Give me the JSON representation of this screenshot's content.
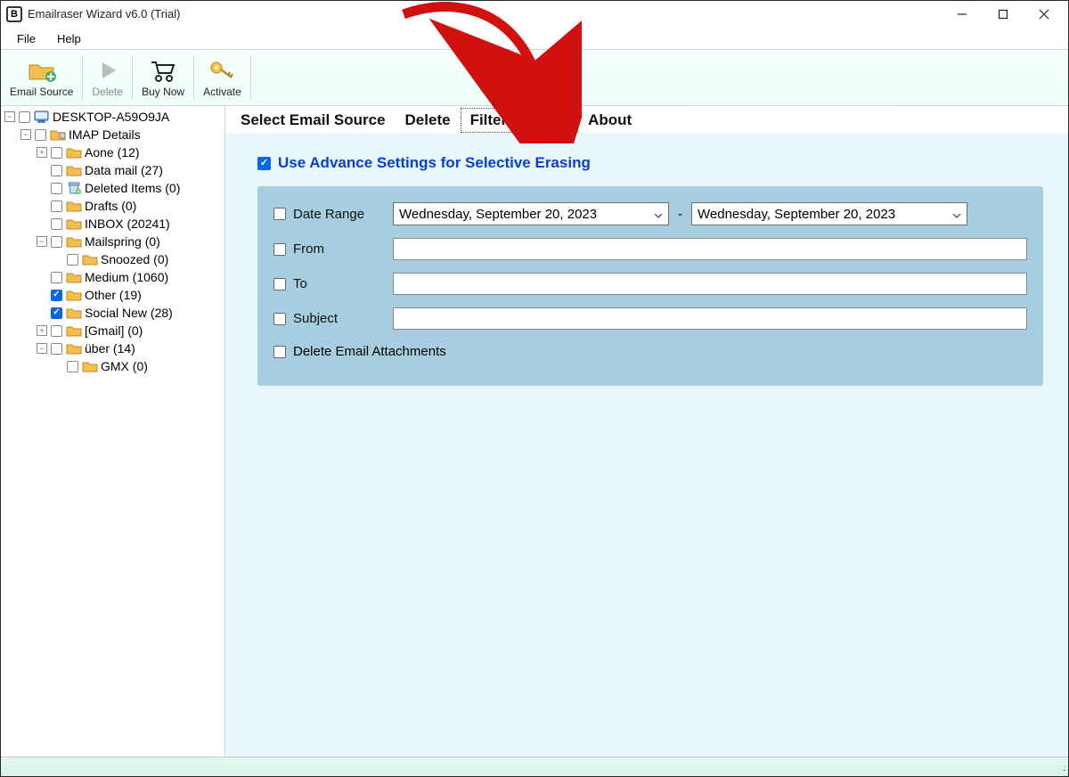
{
  "window": {
    "title": "Emailraser Wizard v6.0 (Trial)",
    "app_badge": "B"
  },
  "menu": {
    "file": "File",
    "help": "Help"
  },
  "toolbar": {
    "email_source": "Email Source",
    "delete": "Delete",
    "buy_now": "Buy Now",
    "activate": "Activate"
  },
  "tabs": {
    "select_source": "Select Email Source",
    "delete": "Delete",
    "filter": "Filter Options",
    "about": "About"
  },
  "filter": {
    "use_advance": "Use Advance Settings for Selective Erasing",
    "date_range": "Date Range",
    "date_from": "Wednesday, September 20, 2023",
    "date_to": "Wednesday, September 20, 2023",
    "dash": "-",
    "from": "From",
    "to": "To",
    "subject": "Subject",
    "del_attach": "Delete Email Attachments"
  },
  "tree": [
    {
      "indent": 0,
      "twist": "-",
      "cb": false,
      "icon": "pc",
      "label": "DESKTOP-A59O9JA"
    },
    {
      "indent": 1,
      "twist": "-",
      "cb": false,
      "icon": "folderdb",
      "label": "IMAP Details"
    },
    {
      "indent": 2,
      "twist": "+",
      "cb": false,
      "icon": "folder",
      "label": "Aone (12)"
    },
    {
      "indent": 2,
      "twist": "",
      "cb": false,
      "icon": "folder",
      "label": "Data mail (27)"
    },
    {
      "indent": 2,
      "twist": "",
      "cb": false,
      "icon": "trash",
      "label": "Deleted Items (0)"
    },
    {
      "indent": 2,
      "twist": "",
      "cb": false,
      "icon": "folder",
      "label": "Drafts (0)"
    },
    {
      "indent": 2,
      "twist": "",
      "cb": false,
      "icon": "folder",
      "label": "INBOX (20241)"
    },
    {
      "indent": 2,
      "twist": "-",
      "cb": false,
      "icon": "folder",
      "label": "Mailspring (0)"
    },
    {
      "indent": 3,
      "twist": "",
      "cb": false,
      "icon": "folder",
      "label": "Snoozed (0)"
    },
    {
      "indent": 2,
      "twist": "",
      "cb": false,
      "icon": "folder",
      "label": "Medium (1060)"
    },
    {
      "indent": 2,
      "twist": "",
      "cb": true,
      "icon": "folder",
      "label": "Other (19)"
    },
    {
      "indent": 2,
      "twist": "",
      "cb": true,
      "icon": "folder",
      "label": "Social New (28)"
    },
    {
      "indent": 2,
      "twist": "+",
      "cb": false,
      "icon": "folder",
      "label": "[Gmail] (0)"
    },
    {
      "indent": 2,
      "twist": "-",
      "cb": false,
      "icon": "folder",
      "label": "über (14)"
    },
    {
      "indent": 3,
      "twist": "",
      "cb": false,
      "icon": "folder",
      "label": "GMX (0)"
    }
  ]
}
